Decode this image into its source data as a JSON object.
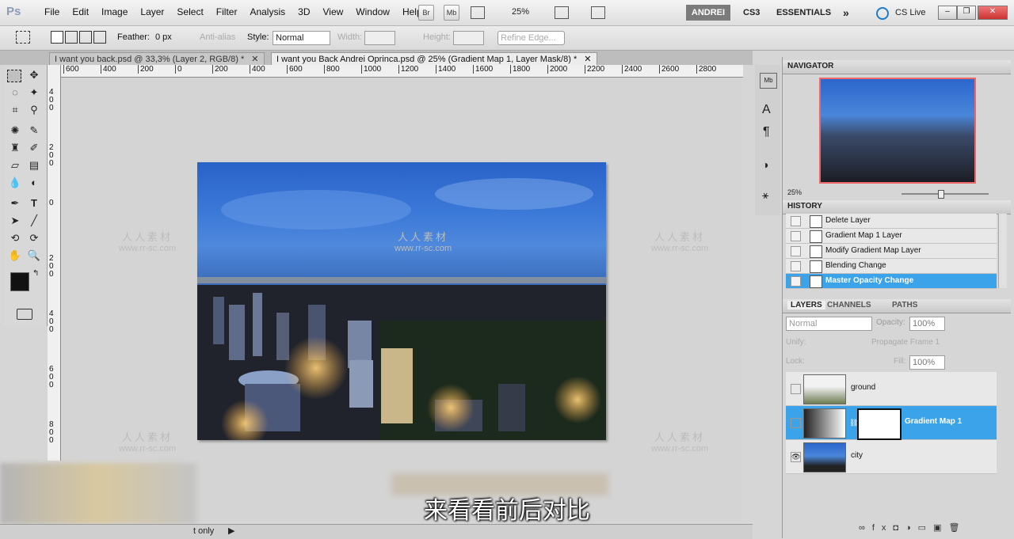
{
  "app": {
    "logo": "Ps"
  },
  "menu": [
    "File",
    "Edit",
    "Image",
    "Layer",
    "Select",
    "Filter",
    "Analysis",
    "3D",
    "View",
    "Window",
    "Help"
  ],
  "topbar": {
    "br_btn": "Br",
    "mb_btn": "Mb",
    "zoom": "25%",
    "workspace_user": "ANDREI",
    "workspace_cs3": "CS3",
    "workspace_essentials": "ESSENTIALS",
    "more": "»",
    "cs_live": "CS Live"
  },
  "options": {
    "feather_label": "Feather:",
    "feather_value": "0 px",
    "antialias": "Anti-alias",
    "style_label": "Style:",
    "style_value": "Normal",
    "width_label": "Width:",
    "height_label": "Height:",
    "refine": "Refine Edge..."
  },
  "tabs": [
    {
      "label": "I want you back.psd @ 33,3% (Layer 2, RGB/8) *",
      "close": "✕"
    },
    {
      "label": "I want you Back Andrei Oprinca.psd @ 25% (Gradient Map 1, Layer Mask/8) *",
      "close": "✕"
    }
  ],
  "ruler": {
    "h_ticks": [
      "600",
      "400",
      "200",
      "0",
      "200",
      "400",
      "600",
      "800",
      "1000",
      "1200",
      "1400",
      "1600",
      "1800",
      "2000",
      "2200",
      "2400",
      "2600",
      "2800"
    ],
    "v_ticks": [
      "400",
      "200",
      "0",
      "200",
      "400",
      "600",
      "800"
    ]
  },
  "navigator": {
    "title": "NAVIGATOR",
    "zoom": "25%"
  },
  "history": {
    "title": "HISTORY",
    "items": [
      {
        "label": "Delete Layer",
        "selected": false
      },
      {
        "label": "Gradient Map 1 Layer",
        "selected": false
      },
      {
        "label": "Modify Gradient Map Layer",
        "selected": false
      },
      {
        "label": "Blending Change",
        "selected": false
      },
      {
        "label": "Master Opacity Change",
        "selected": true
      }
    ]
  },
  "layers": {
    "tabs": [
      "LAYERS",
      "CHANNELS",
      "PATHS"
    ],
    "blend": "Normal",
    "opacity_label": "Opacity:",
    "opacity": "100%",
    "unify": "Unify:",
    "propagate": "Propagate Frame 1",
    "lock": "Lock:",
    "fill_label": "Fill:",
    "fill": "100%",
    "items": [
      {
        "name": "ground",
        "visible": false,
        "selected": false
      },
      {
        "name": "Gradient Map 1",
        "visible": false,
        "selected": true
      },
      {
        "name": "city",
        "visible": true,
        "selected": false
      }
    ]
  },
  "watermark": {
    "cn": "人人素材",
    "url": "www.rr-sc.com"
  },
  "subtitle": "来看看前后对比",
  "status": {
    "text": "t only"
  },
  "colors": {
    "accent": "#3a9be6",
    "selection": "#3aa3ea"
  }
}
